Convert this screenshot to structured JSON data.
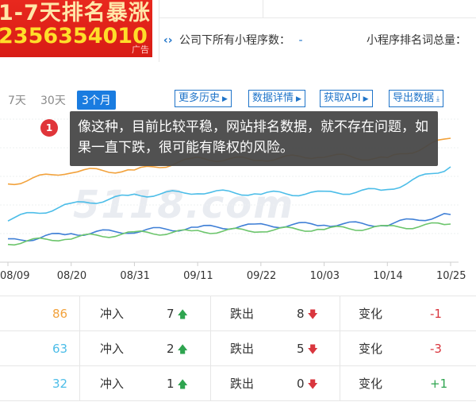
{
  "ad": {
    "line1": "1-7天排名暴涨",
    "line2": "2356354010",
    "tag": "广告"
  },
  "header": {
    "company_mini_count_label": "公司下所有小程序数：",
    "company_mini_count_value": "-",
    "mini_rank_words_label": "小程序排名词总量："
  },
  "toolbar": {
    "ranges": [
      "7天",
      "30天",
      "3个月"
    ],
    "active_range": "3个月",
    "buttons": [
      "更多历史",
      "数据详情",
      "获取API",
      "导出数据"
    ]
  },
  "tooltip": {
    "number": "1",
    "text": "像这种，目前比较平稳，网站排名数据，就不存在问题，如果一直下跌，很可能有降权的风险。"
  },
  "watermark": "5118.com",
  "colors": {
    "orange": "#f2a23c",
    "cyan": "#4cbde8",
    "blue": "#3f7fd6",
    "green": "#6cc56c",
    "accent": "#1f74c9",
    "up": "#2ea44f",
    "down": "#d9363e"
  },
  "chart_data": {
    "type": "line",
    "x": [
      "08/09",
      "08/20",
      "08/31",
      "09/11",
      "09/22",
      "10/03",
      "10/14",
      "10/25"
    ],
    "series": [
      {
        "color": "orange",
        "values": [
          232,
          246,
          246,
          258,
          258,
          262,
          258,
          280
        ]
      },
      {
        "color": "cyan",
        "values": [
          195,
          210,
          220,
          224,
          222,
          222,
          226,
          250
        ]
      },
      {
        "color": "blue",
        "values": [
          172,
          180,
          183,
          186,
          188,
          190,
          190,
          200
        ]
      },
      {
        "color": "green",
        "values": [
          170,
          176,
          180,
          182,
          184,
          185,
          186,
          190
        ]
      }
    ],
    "grid": true
  },
  "table": {
    "rows": [
      {
        "value": "86",
        "value_color": "orange",
        "in_label": "冲入",
        "in_count": "7",
        "out_label": "跌出",
        "out_count": "8",
        "change_label": "变化",
        "change": "-1"
      },
      {
        "value": "63",
        "value_color": "cyan",
        "in_label": "冲入",
        "in_count": "2",
        "out_label": "跌出",
        "out_count": "5",
        "change_label": "变化",
        "change": "-3"
      },
      {
        "value": "32",
        "value_color": "cyan",
        "in_label": "冲入",
        "in_count": "1",
        "out_label": "跌出",
        "out_count": "0",
        "change_label": "变化",
        "change": "+1"
      }
    ]
  },
  "icons": {
    "company": "code-bracket-icon",
    "arrow": "triangle-right-icon",
    "export": "download-icon",
    "up": "arrow-up-icon",
    "down": "arrow-down-icon"
  }
}
